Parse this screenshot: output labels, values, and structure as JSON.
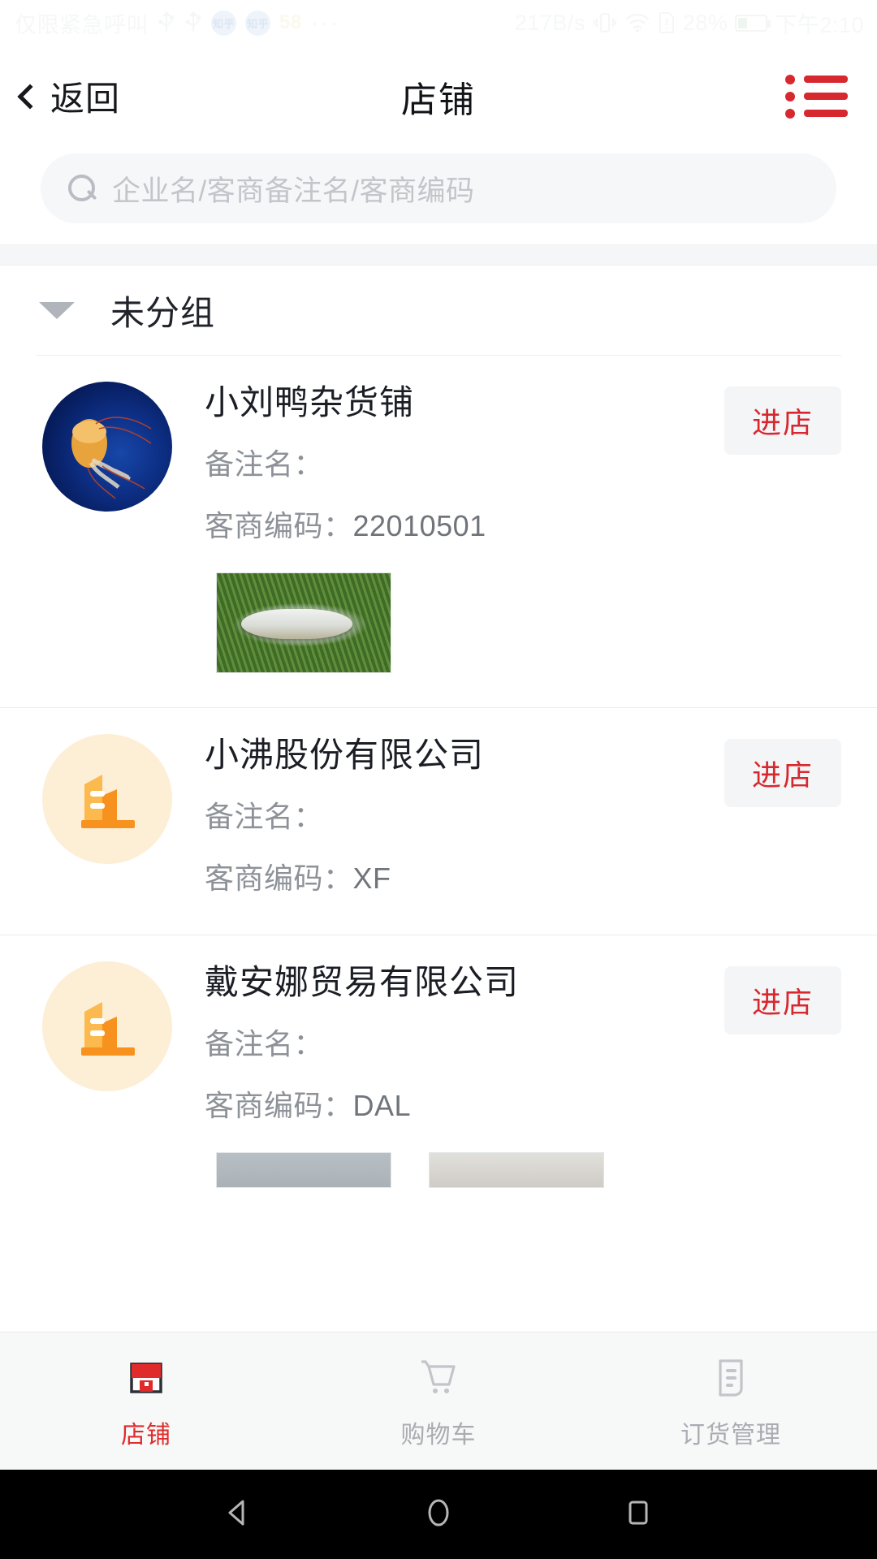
{
  "status_bar": {
    "carrier": "仅限紧急呼叫",
    "usb_icon_1": "usb-icon",
    "usb_icon_2": "usb-icon",
    "app_badge_1": "知乎",
    "app_badge_2": "知乎",
    "notif_count": "58",
    "overflow": "···",
    "network_speed": "217B/s",
    "vibrate_icon": "vibrate-icon",
    "wifi_icon": "wifi-icon",
    "sim_icon": "sim-alert-icon",
    "battery_percent": "28%",
    "time": "下午2:10"
  },
  "header": {
    "back_label": "返回",
    "title": "店铺",
    "menu_icon": "list-menu-icon"
  },
  "search": {
    "placeholder": "企业名/客商备注名/客商编码",
    "icon": "search-icon"
  },
  "group": {
    "name": "未分组",
    "caret_icon": "chevron-down-icon"
  },
  "labels": {
    "alias_label": "备注名：",
    "code_label": "客商编码：",
    "enter_store": "进店"
  },
  "stores": [
    {
      "name": "小刘鸭杂货铺",
      "alias": "",
      "code": "22010501",
      "avatar_type": "photo-jellyfish",
      "button": "进店",
      "thumbnails": [
        "product-photo-fish"
      ]
    },
    {
      "name": "小沸股份有限公司",
      "alias": "",
      "code": "XF",
      "avatar_type": "company-building-icon",
      "button": "进店",
      "thumbnails": []
    },
    {
      "name": "戴安娜贸易有限公司",
      "alias": "",
      "code": "DAL",
      "avatar_type": "company-building-icon",
      "button": "进店",
      "thumbnails": [
        "product-photo-grey",
        "product-photo-beige"
      ]
    }
  ],
  "tabs": [
    {
      "label": "店铺",
      "icon": "shop-icon",
      "active": true
    },
    {
      "label": "购物车",
      "icon": "cart-icon",
      "active": false
    },
    {
      "label": "订货管理",
      "icon": "order-list-icon",
      "active": false
    }
  ],
  "android_nav": {
    "back": "nav-back-icon",
    "home": "nav-home-icon",
    "recents": "nav-recents-icon"
  },
  "colors": {
    "accent_red": "#d7282f",
    "tab_active": "#e02b2b",
    "company_icon_orange": "#f99d2a",
    "muted_text": "#8d9298"
  }
}
